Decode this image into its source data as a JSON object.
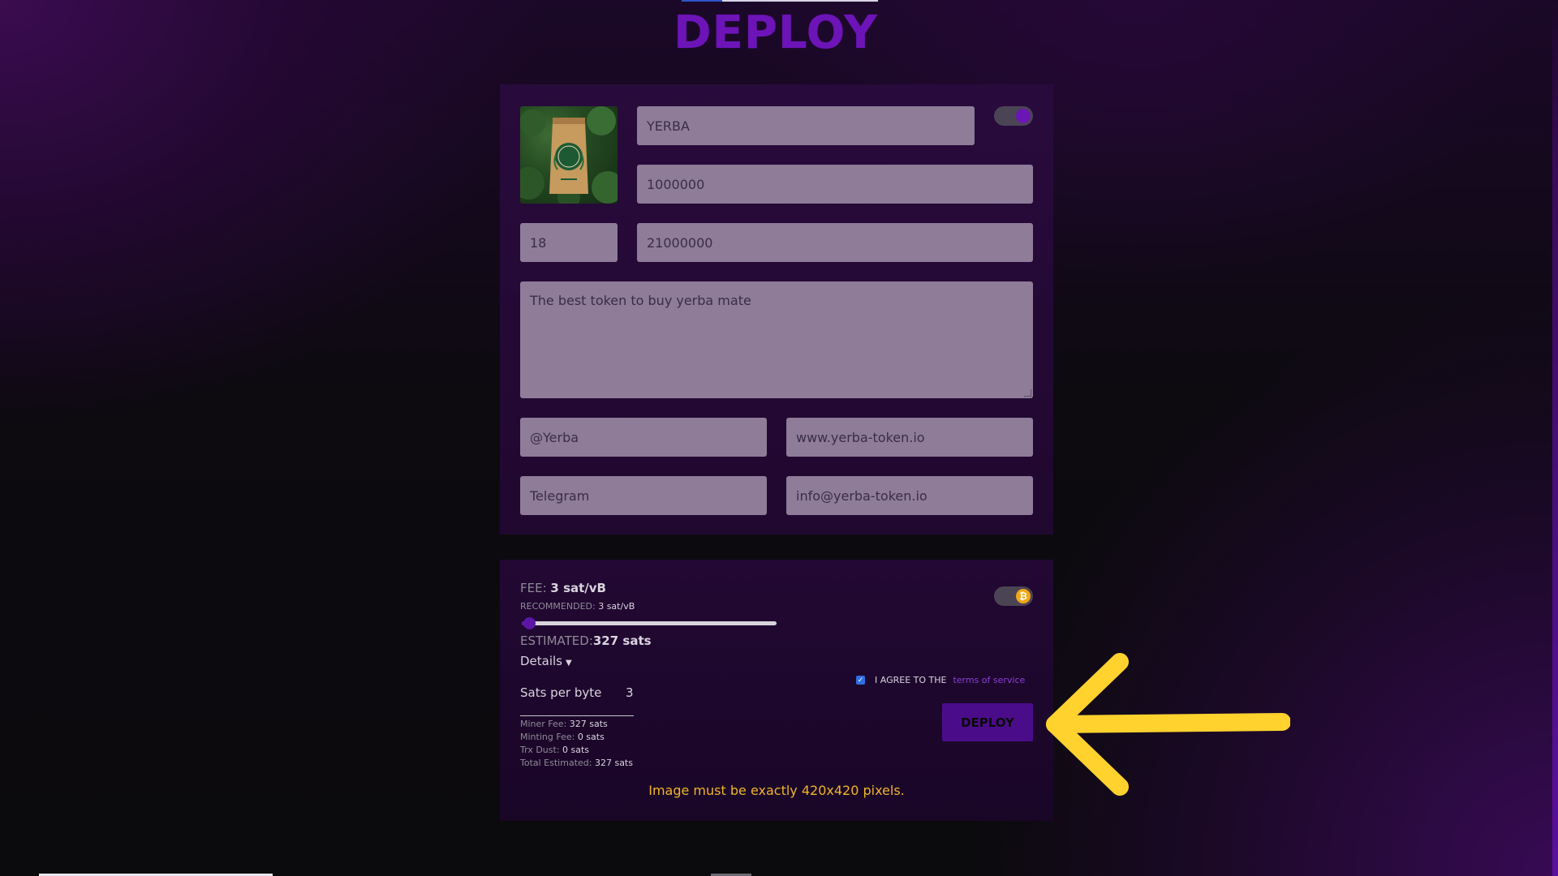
{
  "page": {
    "title": "DEPLOY"
  },
  "token_form": {
    "name": "YERBA",
    "amount": "1000000",
    "decimals": "18",
    "max_supply": "21000000",
    "description": "The best token to buy yerba mate",
    "twitter": "@Yerba",
    "website": "www.yerba-token.io",
    "telegram_placeholder": "Telegram",
    "email": "info@yerba-token.io"
  },
  "fees": {
    "fee_label": "FEE:",
    "fee_value": "3 sat/vB",
    "recommended_label": "RECOMMENDED:",
    "recommended_value": "3 sat/vB",
    "slider_fraction": 0.03,
    "estimated_label": "ESTIMATED:",
    "estimated_value": "327 sats",
    "details_label": "Details",
    "sats_per_byte_label": "Sats per byte",
    "sats_per_byte_value": "3",
    "rows": [
      {
        "label": "Miner Fee:",
        "value": "327 sats"
      },
      {
        "label": "Minting Fee:",
        "value": "0 sats"
      },
      {
        "label": "Trx Dust:",
        "value": "0 sats"
      },
      {
        "label": "Total Estimated:",
        "value": "327 sats"
      }
    ]
  },
  "agreement": {
    "checked": true,
    "text": "I AGREE TO THE",
    "link": "terms of service"
  },
  "deploy_button": "DEPLOY",
  "warning": "Image must be exactly 420x420 pixels.",
  "colors": {
    "brand_purple": "#6d14b8",
    "warning": "#f0b429",
    "bitcoin": "#f2a516",
    "annotation_arrow": "#ffd22e"
  }
}
